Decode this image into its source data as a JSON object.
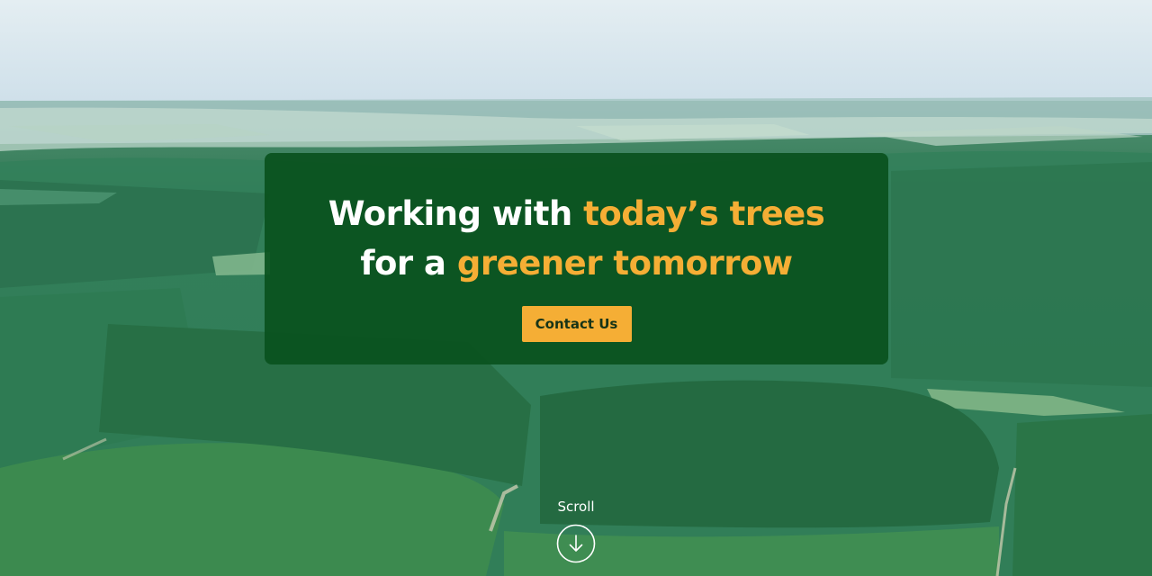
{
  "hero": {
    "headline": {
      "line1": {
        "prefix": "Working with ",
        "highlight": "today’s trees"
      },
      "line2": {
        "prefix": "for a ",
        "highlight": "greener tomorrow"
      }
    },
    "cta_label": "Contact Us",
    "scroll_label": "Scroll",
    "scroll_icon": "arrow-down-circle-icon"
  },
  "colors": {
    "card": "#0a521e",
    "accent": "#f5ae35",
    "button_text": "#173417",
    "text": "#ffffff"
  }
}
